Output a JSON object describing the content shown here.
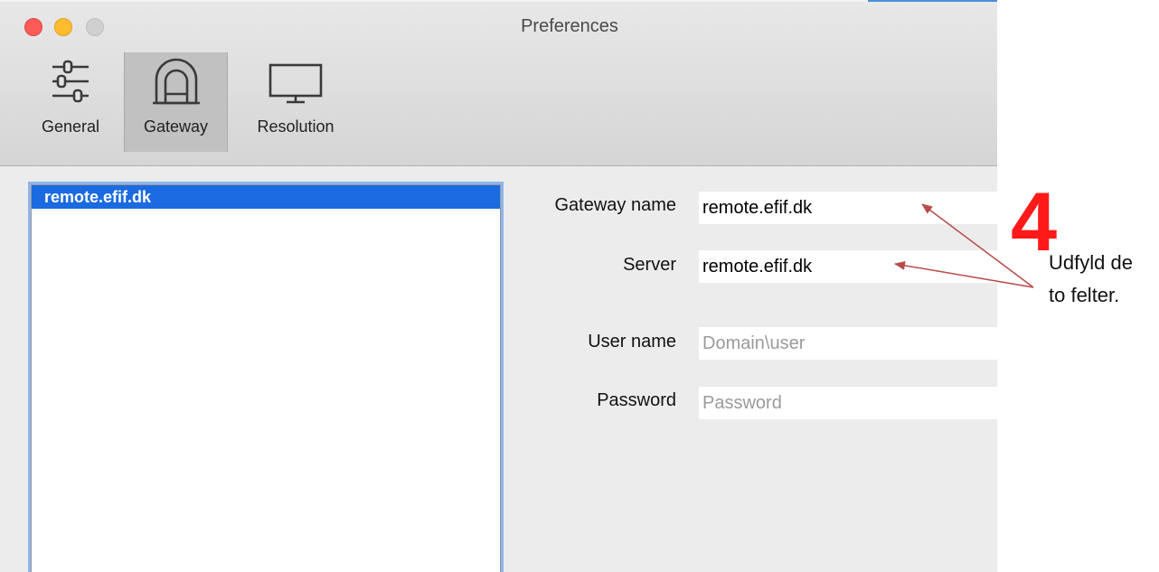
{
  "window": {
    "title": "Preferences"
  },
  "toolbar": {
    "tabs": [
      {
        "label": "General",
        "icon": "sliders-icon"
      },
      {
        "label": "Gateway",
        "icon": "tunnel-icon",
        "selected": true
      },
      {
        "label": "Resolution",
        "icon": "monitor-icon"
      }
    ]
  },
  "gateway_list": {
    "items": [
      "remote.efif.dk"
    ]
  },
  "form": {
    "gateway_name": {
      "label": "Gateway name",
      "value": "remote.efif.dk"
    },
    "server": {
      "label": "Server",
      "value": "remote.efif.dk"
    },
    "user_name": {
      "label": "User name",
      "placeholder": "Domain\\user"
    },
    "password": {
      "label": "Password",
      "placeholder": "Password"
    }
  },
  "annotation": {
    "number": "4",
    "line1": "Udfyld de",
    "line2": "to felter.",
    "color": "#ff1a1a",
    "arrow_color": "#b84a4a"
  }
}
